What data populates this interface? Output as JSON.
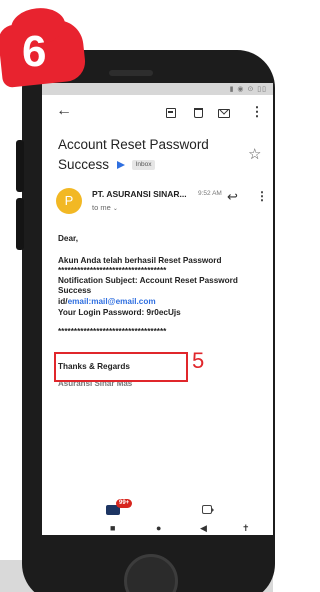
{
  "step_number": "6",
  "annotation_number": "5",
  "status_bar": {
    "time": "",
    "icons": "▮ ◉ ⊙ ▯▯"
  },
  "toolbar": {
    "back_icon": "←",
    "more_icon": "⋮"
  },
  "email": {
    "subject": "Account Reset Password Success",
    "label": "Inbox",
    "star_icon": "☆",
    "sender_initial": "P",
    "sender": "PT. ASURANSI SINAR...",
    "time": "9:52 AM",
    "to": "to me",
    "reply_icon": "↩",
    "greeting": "Dear,",
    "line1": "Akun Anda telah berhasil Reset Password",
    "separator": "**********************************",
    "notification_subject": "Notification Subject: Account Reset Password Success",
    "id_prefix": "id/",
    "id_email": "email:mail@email.com",
    "password_line": "Your Login Password: 9r0ecUjs",
    "separator2": "**********************************",
    "thanks": "Thanks & Regards",
    "company": "Asuransi Sinar Mas"
  },
  "bottom_nav": {
    "mail_badge": "99+",
    "android_square": "■",
    "android_home": "●",
    "android_back": "◀",
    "android_access": "✝"
  }
}
